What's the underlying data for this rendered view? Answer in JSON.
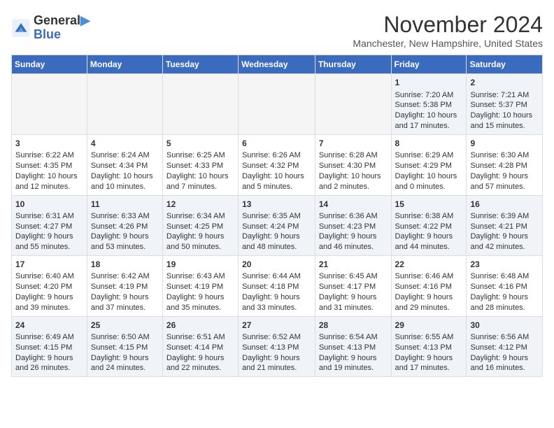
{
  "logo": {
    "line1": "General",
    "line2": "Blue"
  },
  "title": "November 2024",
  "subtitle": "Manchester, New Hampshire, United States",
  "days_of_week": [
    "Sunday",
    "Monday",
    "Tuesday",
    "Wednesday",
    "Thursday",
    "Friday",
    "Saturday"
  ],
  "weeks": [
    [
      {
        "day": "",
        "info": ""
      },
      {
        "day": "",
        "info": ""
      },
      {
        "day": "",
        "info": ""
      },
      {
        "day": "",
        "info": ""
      },
      {
        "day": "",
        "info": ""
      },
      {
        "day": "1",
        "info": "Sunrise: 7:20 AM\nSunset: 5:38 PM\nDaylight: 10 hours and 17 minutes."
      },
      {
        "day": "2",
        "info": "Sunrise: 7:21 AM\nSunset: 5:37 PM\nDaylight: 10 hours and 15 minutes."
      }
    ],
    [
      {
        "day": "3",
        "info": "Sunrise: 6:22 AM\nSunset: 4:35 PM\nDaylight: 10 hours and 12 minutes."
      },
      {
        "day": "4",
        "info": "Sunrise: 6:24 AM\nSunset: 4:34 PM\nDaylight: 10 hours and 10 minutes."
      },
      {
        "day": "5",
        "info": "Sunrise: 6:25 AM\nSunset: 4:33 PM\nDaylight: 10 hours and 7 minutes."
      },
      {
        "day": "6",
        "info": "Sunrise: 6:26 AM\nSunset: 4:32 PM\nDaylight: 10 hours and 5 minutes."
      },
      {
        "day": "7",
        "info": "Sunrise: 6:28 AM\nSunset: 4:30 PM\nDaylight: 10 hours and 2 minutes."
      },
      {
        "day": "8",
        "info": "Sunrise: 6:29 AM\nSunset: 4:29 PM\nDaylight: 10 hours and 0 minutes."
      },
      {
        "day": "9",
        "info": "Sunrise: 6:30 AM\nSunset: 4:28 PM\nDaylight: 9 hours and 57 minutes."
      }
    ],
    [
      {
        "day": "10",
        "info": "Sunrise: 6:31 AM\nSunset: 4:27 PM\nDaylight: 9 hours and 55 minutes."
      },
      {
        "day": "11",
        "info": "Sunrise: 6:33 AM\nSunset: 4:26 PM\nDaylight: 9 hours and 53 minutes."
      },
      {
        "day": "12",
        "info": "Sunrise: 6:34 AM\nSunset: 4:25 PM\nDaylight: 9 hours and 50 minutes."
      },
      {
        "day": "13",
        "info": "Sunrise: 6:35 AM\nSunset: 4:24 PM\nDaylight: 9 hours and 48 minutes."
      },
      {
        "day": "14",
        "info": "Sunrise: 6:36 AM\nSunset: 4:23 PM\nDaylight: 9 hours and 46 minutes."
      },
      {
        "day": "15",
        "info": "Sunrise: 6:38 AM\nSunset: 4:22 PM\nDaylight: 9 hours and 44 minutes."
      },
      {
        "day": "16",
        "info": "Sunrise: 6:39 AM\nSunset: 4:21 PM\nDaylight: 9 hours and 42 minutes."
      }
    ],
    [
      {
        "day": "17",
        "info": "Sunrise: 6:40 AM\nSunset: 4:20 PM\nDaylight: 9 hours and 39 minutes."
      },
      {
        "day": "18",
        "info": "Sunrise: 6:42 AM\nSunset: 4:19 PM\nDaylight: 9 hours and 37 minutes."
      },
      {
        "day": "19",
        "info": "Sunrise: 6:43 AM\nSunset: 4:19 PM\nDaylight: 9 hours and 35 minutes."
      },
      {
        "day": "20",
        "info": "Sunrise: 6:44 AM\nSunset: 4:18 PM\nDaylight: 9 hours and 33 minutes."
      },
      {
        "day": "21",
        "info": "Sunrise: 6:45 AM\nSunset: 4:17 PM\nDaylight: 9 hours and 31 minutes."
      },
      {
        "day": "22",
        "info": "Sunrise: 6:46 AM\nSunset: 4:16 PM\nDaylight: 9 hours and 29 minutes."
      },
      {
        "day": "23",
        "info": "Sunrise: 6:48 AM\nSunset: 4:16 PM\nDaylight: 9 hours and 28 minutes."
      }
    ],
    [
      {
        "day": "24",
        "info": "Sunrise: 6:49 AM\nSunset: 4:15 PM\nDaylight: 9 hours and 26 minutes."
      },
      {
        "day": "25",
        "info": "Sunrise: 6:50 AM\nSunset: 4:15 PM\nDaylight: 9 hours and 24 minutes."
      },
      {
        "day": "26",
        "info": "Sunrise: 6:51 AM\nSunset: 4:14 PM\nDaylight: 9 hours and 22 minutes."
      },
      {
        "day": "27",
        "info": "Sunrise: 6:52 AM\nSunset: 4:13 PM\nDaylight: 9 hours and 21 minutes."
      },
      {
        "day": "28",
        "info": "Sunrise: 6:54 AM\nSunset: 4:13 PM\nDaylight: 9 hours and 19 minutes."
      },
      {
        "day": "29",
        "info": "Sunrise: 6:55 AM\nSunset: 4:13 PM\nDaylight: 9 hours and 17 minutes."
      },
      {
        "day": "30",
        "info": "Sunrise: 6:56 AM\nSunset: 4:12 PM\nDaylight: 9 hours and 16 minutes."
      }
    ]
  ]
}
